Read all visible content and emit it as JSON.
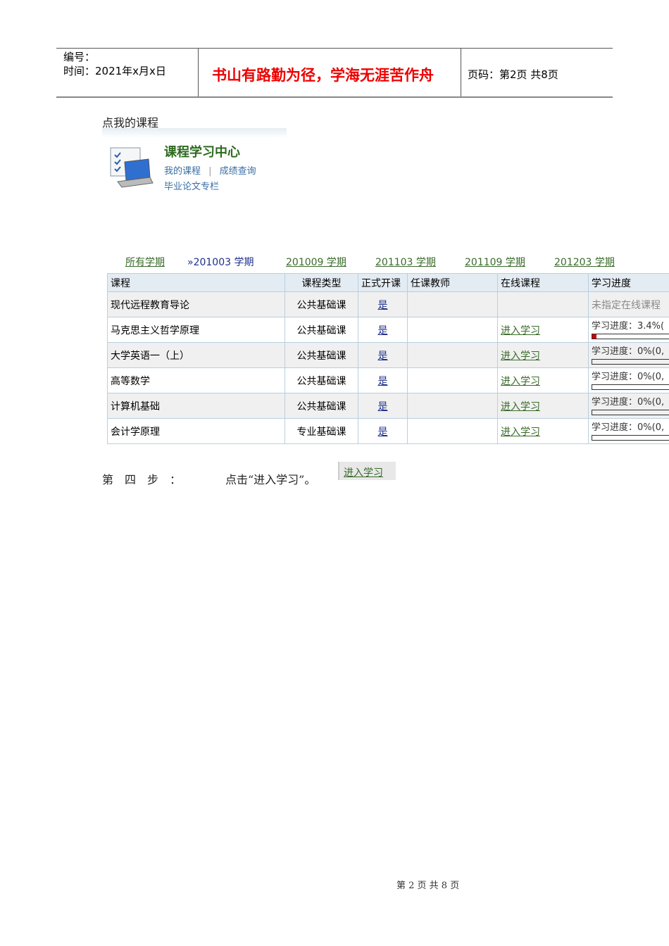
{
  "header": {
    "number_label": "编号：",
    "time_label": "时间：2021年x月x日",
    "motto": "书山有路勤为径，学海无涯苦作舟",
    "page_label": "页码：第2页  共8页"
  },
  "intro": "点我的课程",
  "card": {
    "title": "课程学习中心",
    "link_my_courses": "我的课程",
    "separator": "|",
    "link_grades": "成绩查询",
    "link_thesis": "毕业论文专栏"
  },
  "terms": [
    {
      "label": "所有学期"
    },
    {
      "label": "»201003 学期"
    },
    {
      "label": "201009 学期"
    },
    {
      "label": "201103 学期"
    },
    {
      "label": "201109 学期"
    },
    {
      "label": "201203 学期"
    }
  ],
  "table": {
    "headers": [
      "课程",
      "课程类型",
      "正式开课",
      "任课教师",
      "在线课程",
      "学习进度"
    ],
    "rows": [
      {
        "course": "现代远程教育导论",
        "type": "公共基础课",
        "official": "是",
        "teacher": "",
        "online": "",
        "progress": "未指定在线课程",
        "pct": null
      },
      {
        "course": "马克思主义哲学原理",
        "type": "公共基础课",
        "official": "是",
        "teacher": "",
        "online": "进入学习",
        "progress": "学习进度：3.4%(",
        "pct": 3.4
      },
      {
        "course": "大学英语一（上）",
        "type": "公共基础课",
        "official": "是",
        "teacher": "",
        "online": "进入学习",
        "progress": "学习进度：0%(0,",
        "pct": 0
      },
      {
        "course": "高等数学",
        "type": "公共基础课",
        "official": "是",
        "teacher": "",
        "online": "进入学习",
        "progress": "学习进度：0%(0,",
        "pct": 0
      },
      {
        "course": "计算机基础",
        "type": "公共基础课",
        "official": "是",
        "teacher": "",
        "online": "进入学习",
        "progress": "学习进度：0%(0,",
        "pct": 0
      },
      {
        "course": "会计学原理",
        "type": "专业基础课",
        "official": "是",
        "teacher": "",
        "online": "进入学习",
        "progress": "学习进度：0%(0,",
        "pct": 0
      }
    ]
  },
  "step": {
    "label": "第　四　步　：",
    "text": "点击“进入学习”。",
    "button": "进入学习"
  },
  "footer": "第 2 页 共 8 页"
}
